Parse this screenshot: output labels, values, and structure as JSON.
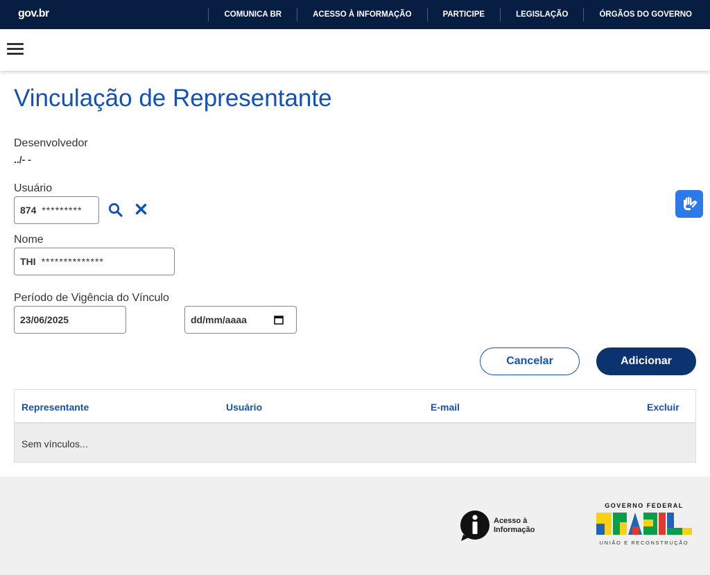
{
  "govbar": {
    "logo": "gov.br",
    "links": [
      "COMUNICA BR",
      "ACESSO À INFORMAÇÃO",
      "PARTICIPE",
      "LEGISLAÇÃO",
      "ÓRGÃOS DO GOVERNO"
    ]
  },
  "page": {
    "title": "Vinculação de Representante"
  },
  "form": {
    "developer_label": "Desenvolvedor",
    "developer_value": "../- -",
    "user_label": "Usuário",
    "user_prefix": "874",
    "user_mask": "*********",
    "name_label": "Nome",
    "name_prefix": "THI",
    "name_mask": "**************",
    "period_label": "Período de Vigência do Vínculo",
    "start_date": "23/06/2025",
    "end_date_placeholder": "dd/mm/aaaa"
  },
  "actions": {
    "cancel": "Cancelar",
    "add": "Adicionar"
  },
  "table": {
    "headers": [
      "Representante",
      "Usuário",
      "E-mail",
      "Excluir"
    ],
    "empty_text": "Sem vínculos..."
  },
  "footer": {
    "access_info_line1": "Acesso à",
    "access_info_line2": "Informação",
    "brand_top": "GOVERNO FEDERAL",
    "brand_word": "BRASIL",
    "brand_bottom": "UNIÃO E RECONSTRUÇÃO"
  },
  "colors": {
    "primary": "#1351b4",
    "dark_blue": "#0c326f",
    "navy": "#071d41"
  }
}
